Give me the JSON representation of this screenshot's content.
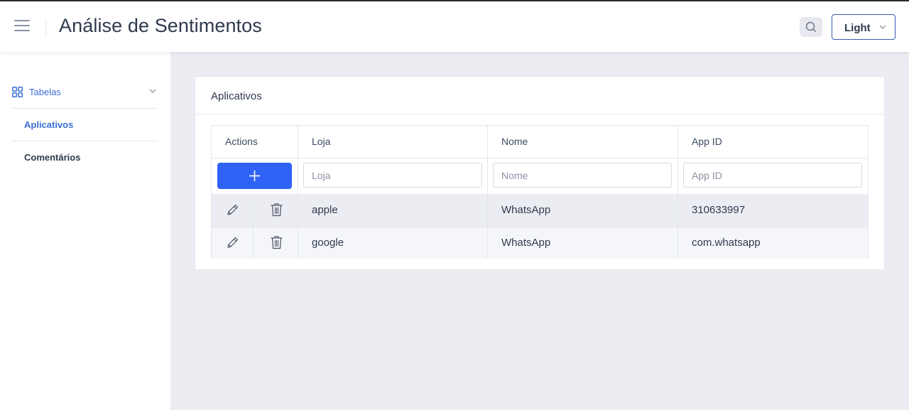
{
  "header": {
    "title": "Análise de Sentimentos",
    "theme_select": "Light",
    "icons": {
      "menu": "hamburger-menu-icon",
      "search": "search-icon",
      "dropdown": "chevron-down-icon"
    }
  },
  "sidebar": {
    "group": {
      "label": "Tabelas",
      "icon": "grid-icon",
      "expanded": true
    },
    "items": [
      {
        "label": "Aplicativos",
        "active": true
      },
      {
        "label": "Comentários",
        "active": false
      }
    ]
  },
  "card": {
    "title": "Aplicativos",
    "table": {
      "columns": [
        "Actions",
        "Loja",
        "Nome",
        "App ID"
      ],
      "filters": {
        "loja_placeholder": "Loja",
        "nome_placeholder": "Nome",
        "appid_placeholder": "App ID"
      },
      "rows": [
        {
          "loja": "apple",
          "nome": "WhatsApp",
          "app_id": "310633997"
        },
        {
          "loja": "google",
          "nome": "WhatsApp",
          "app_id": "com.whatsapp"
        }
      ],
      "row_icons": [
        "pencil-icon",
        "trash-icon"
      ],
      "add_icon": "plus-icon"
    }
  },
  "colors": {
    "accent": "#2f63f5",
    "link": "#3b6fd4",
    "background": "#ebedf3"
  }
}
